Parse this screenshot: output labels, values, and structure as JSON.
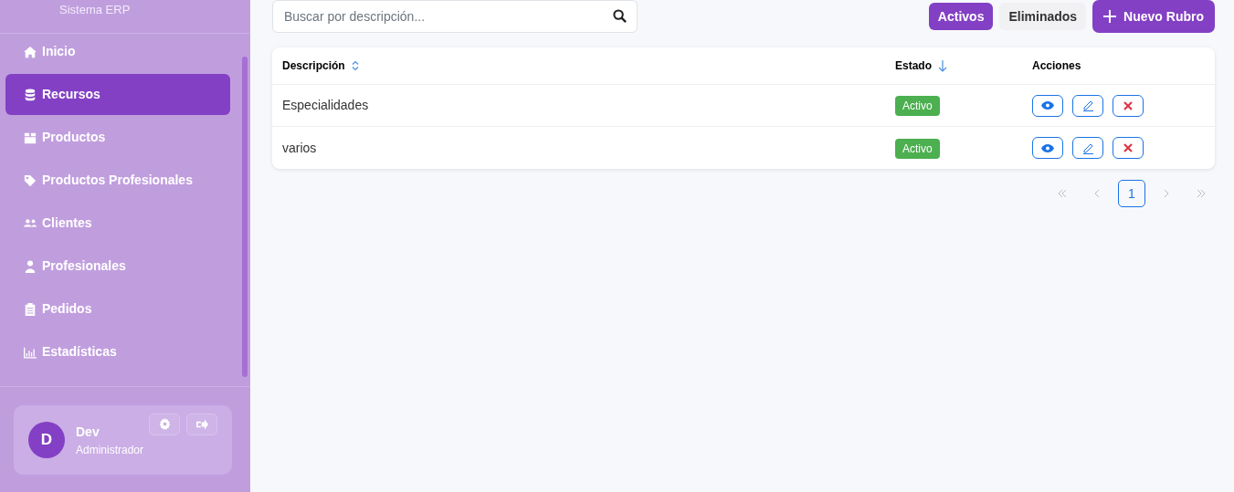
{
  "sidebar": {
    "subtitle": "Sistema ERP",
    "items": [
      {
        "label": "Inicio",
        "kind": "home",
        "selected": false
      },
      {
        "label": "Recursos",
        "kind": "database",
        "selected": true
      },
      {
        "label": "Productos",
        "kind": "box",
        "selected": false
      },
      {
        "label": "Productos Profesionales",
        "kind": "tag",
        "selected": false
      },
      {
        "label": "Clientes",
        "kind": "users",
        "selected": false
      },
      {
        "label": "Profesionales",
        "kind": "person",
        "selected": false
      },
      {
        "label": "Pedidos",
        "kind": "clipboard",
        "selected": false
      },
      {
        "label": "Estadísticas",
        "kind": "chart",
        "selected": false
      }
    ],
    "user": {
      "initial": "D",
      "name": "Dev",
      "role": "Administrador"
    }
  },
  "search": {
    "placeholder": "Buscar por descripción..."
  },
  "filters": [
    {
      "label": "Activos",
      "selected": true
    },
    {
      "label": "Eliminados",
      "selected": false
    }
  ],
  "new_button": {
    "label": "Nuevo Rubro"
  },
  "table": {
    "columns": [
      {
        "label": "Descripción",
        "kind": "sortable"
      },
      {
        "label": "Estado",
        "kind": "sorted"
      },
      {
        "label": "Acciones",
        "kind": "plain"
      }
    ],
    "rows": [
      {
        "description": "Especialidades",
        "status": {
          "label": "Activo",
          "kind": "active"
        }
      },
      {
        "description": "varios",
        "status": {
          "label": "Activo",
          "kind": "active"
        }
      }
    ]
  },
  "pagination": {
    "first_disabled": true,
    "prev_disabled": true,
    "pages": [
      {
        "label": "1",
        "selected": true
      }
    ],
    "next_disabled": true,
    "last_disabled": true
  }
}
